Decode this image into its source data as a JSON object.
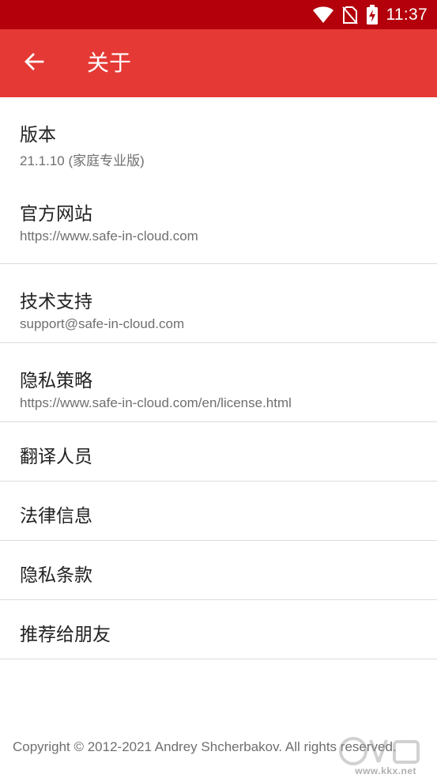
{
  "status_bar": {
    "time": "11:37",
    "icons": [
      "wifi-icon",
      "no-sim-icon",
      "battery-charging-icon"
    ]
  },
  "toolbar": {
    "back_icon": "arrow-left-icon",
    "title": "关于"
  },
  "items": [
    {
      "title": "版本",
      "subtitle": "21.1.10 (家庭专业版)"
    },
    {
      "title": "官方网站",
      "subtitle": "https://www.safe-in-cloud.com"
    },
    {
      "title": "技术支持",
      "subtitle": "support@safe-in-cloud.com"
    },
    {
      "title": "隐私策略",
      "subtitle": "https://www.safe-in-cloud.com/en/license.html"
    },
    {
      "title": "翻译人员"
    },
    {
      "title": "法律信息"
    },
    {
      "title": "隐私条款"
    },
    {
      "title": "推荐给朋友"
    }
  ],
  "footer": {
    "copyright": "Copyright © 2012-2021 Andrey Shcherbakov. All rights reserved."
  },
  "watermark": {
    "url": "www.kkx.net"
  },
  "colors": {
    "status_bar": "#b3000b",
    "toolbar": "#e53935",
    "primary_text": "#222222",
    "secondary_text": "#6f6f6f",
    "divider": "#dcdcdc"
  }
}
